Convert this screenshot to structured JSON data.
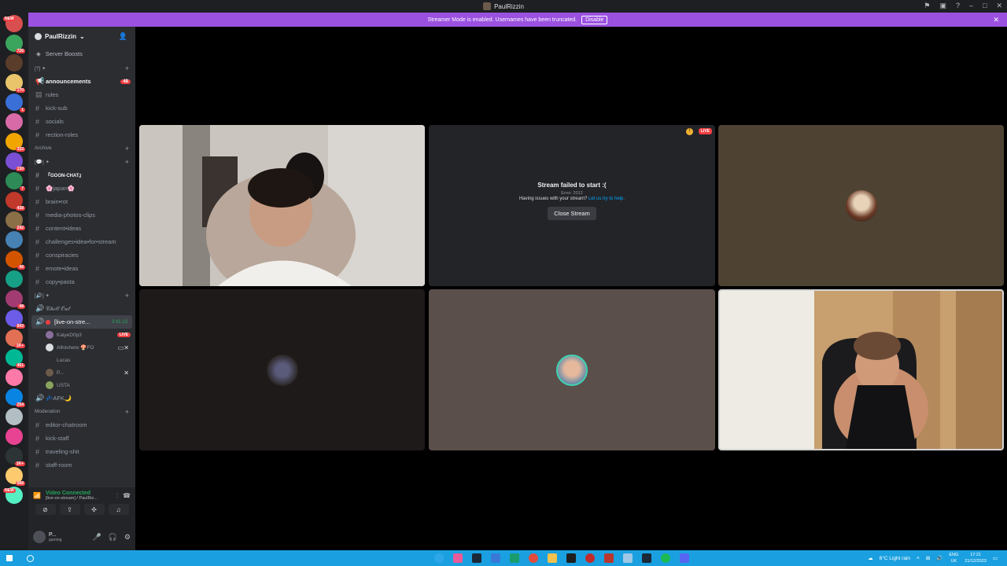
{
  "window": {
    "title": "PaulRizzin"
  },
  "streamer_mode": {
    "message": "Streamer Mode is enabled. Usernames have been truncated.",
    "disable_label": "Disable"
  },
  "guild_rail": {
    "new_badge": "NEW",
    "badges": [
      "30",
      "726",
      "",
      "170",
      "1",
      "",
      "333",
      "130",
      "7",
      "438",
      "242",
      "",
      "49",
      "",
      "48",
      "843",
      "1K+",
      "461",
      "",
      "254",
      "",
      "",
      "1K+",
      "668",
      "NEW"
    ]
  },
  "server": {
    "name": "PaulRizzin",
    "boosts_label": "Server Boosts"
  },
  "categories": {
    "top": "[?] ✦",
    "archive": "Archive",
    "misc": "[💬] ✦",
    "voice": "[🔊] ✦",
    "moderation": "Moderation"
  },
  "channels_top": [
    {
      "name": "announcements",
      "count": "48"
    },
    {
      "name": "rules"
    },
    {
      "name": "kick-sub"
    },
    {
      "name": "socials"
    },
    {
      "name": "rection-roles"
    }
  ],
  "channels_misc": [
    {
      "name": "『GOON-CHAT』"
    },
    {
      "name": "🌸japan🌸"
    },
    {
      "name": "brain•rot"
    },
    {
      "name": "media-photos-clips"
    },
    {
      "name": "content•ideas"
    },
    {
      "name": "challenges•idea•for•stream"
    },
    {
      "name": "conspiracies"
    },
    {
      "name": "emote•ideas"
    },
    {
      "name": "copy•pasta"
    }
  ],
  "voice_channels": {
    "chill": "𝒞𝒽𝒾𝓁𝓁 𝒪𝓊𝓉",
    "live": {
      "name": "[live-on-stre...",
      "time": "3:41:13"
    },
    "users": [
      {
        "name": "KaiyeD0p3",
        "live": "LIVE"
      },
      {
        "name": "Allnishere 🍄FO"
      },
      {
        "name": "Lucas"
      },
      {
        "name": "P..."
      },
      {
        "name": "USTA"
      }
    ],
    "afk": "💤AFK🌙"
  },
  "channels_mod": [
    {
      "name": "editor-chatroom"
    },
    {
      "name": "kick-staff"
    },
    {
      "name": "traveling-shit"
    },
    {
      "name": "staff-room"
    }
  ],
  "voice_panel": {
    "status": "Video Connected",
    "channel": "[live-on-stream] / PaulRiz..."
  },
  "user_panel": {
    "name": "P...",
    "status": "gaming"
  },
  "stream_error": {
    "title": "Stream failed to start :(",
    "code": "Error: 2012",
    "help_prefix": "Having issues with your stream?",
    "help_link": "Let us try to help.",
    "close_button": "Close Stream",
    "live_tag": "LIVE"
  },
  "taskbar": {
    "weather": "6°C  Light rain",
    "lang": "ENG",
    "region": "UK",
    "time": "17:21",
    "date": "21/12/2023"
  },
  "colors": {
    "accent": "#5865f2",
    "streamer_bar": "#9b51e0",
    "live": "#f23f43",
    "taskbar": "#1aa0e0"
  }
}
